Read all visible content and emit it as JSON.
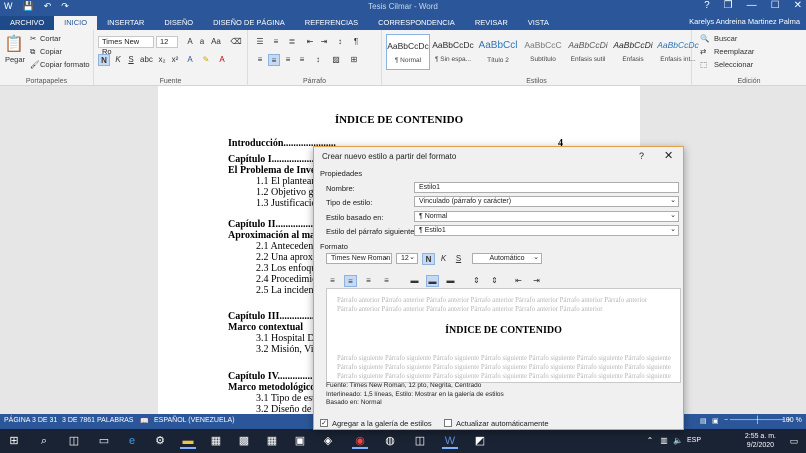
{
  "window": {
    "title": "Tesis Cilmar - Word",
    "help_glyph": "?",
    "restore_glyph": "❐",
    "min_glyph": "—",
    "max_glyph": "☐",
    "close_glyph": "✕",
    "user": "Karelys Andreina Martinez Palma"
  },
  "tabs": [
    "ARCHIVO",
    "INICIO",
    "INSERTAR",
    "DISEÑO",
    "DISEÑO DE PÁGINA",
    "REFERENCIAS",
    "CORRESPONDENCIA",
    "REVISAR",
    "VISTA"
  ],
  "ribbon": {
    "clipboard": {
      "paste": "Pegar",
      "cut": "Cortar",
      "copy": "Copiar",
      "format_painter": "Copiar formato",
      "label": "Portapapeles"
    },
    "font": {
      "name": "Times New Ro",
      "size": "12",
      "label": "Fuente"
    },
    "paragraph": {
      "label": "Párrafo"
    },
    "styles": {
      "label": "Estilos",
      "items": [
        {
          "preview": "AaBbCcDc",
          "name": "¶ Normal"
        },
        {
          "preview": "AaBbCcDc",
          "name": "¶ Sin espa..."
        },
        {
          "preview": "AaBbCcl",
          "name": "Título 2"
        },
        {
          "preview": "AaBbCcC",
          "name": "Subtítulo"
        },
        {
          "preview": "AaBbCcDi",
          "name": "Énfasis sutil"
        },
        {
          "preview": "AaBbCcDi",
          "name": "Énfasis"
        },
        {
          "preview": "AaBbCcDc",
          "name": "Énfasis int..."
        }
      ]
    },
    "editing": {
      "find": "Buscar",
      "replace": "Reemplazar",
      "select": "Seleccionar",
      "label": "Edición"
    }
  },
  "document": {
    "title": "ÍNDICE DE CONTENIDO",
    "lines": [
      {
        "text": "Introducción.....................",
        "bold": true
      },
      {
        "text": "4",
        "bold": true
      },
      {
        "text": "Capítulo   I.........................",
        "bold": true
      },
      {
        "text": "El Problema de Invest",
        "bold": true
      },
      {
        "text": "1.1 El planteam",
        "bold": false
      },
      {
        "text": "1.2 Objetivo gen",
        "bold": false
      },
      {
        "text": "1.3 Justificación",
        "bold": false
      },
      {
        "text": "Capítulo II.........................",
        "bold": true
      },
      {
        "text": "Aproximación al marc",
        "bold": true
      },
      {
        "text": "2.1 Antecedente",
        "bold": false
      },
      {
        "text": "2.2 Una aproxim",
        "bold": false
      },
      {
        "text": "2.3 Los enfoque",
        "bold": false
      },
      {
        "text": "2.4 Procedimien",
        "bold": false
      },
      {
        "text": "2.5 La incidenci",
        "bold": false
      },
      {
        "text": "Capítulo III.........................",
        "bold": true
      },
      {
        "text": "Marco contextual",
        "bold": true
      },
      {
        "text": "3.1 Hospital Dr.",
        "bold": false
      },
      {
        "text": "3.2  Misión, Vi",
        "bold": false
      },
      {
        "text": "Capítulo IV.........................",
        "bold": true
      },
      {
        "text": "Marco metodológico",
        "bold": true
      },
      {
        "text": "3.1  Tipo de est",
        "bold": false
      },
      {
        "text": "3.2 Diseño de la",
        "bold": false
      }
    ]
  },
  "dialog": {
    "title": "Crear nuevo estilo a partir del formato",
    "properties_label": "Propiedades",
    "name_label": "Nombre:",
    "name_value": "Estilo1",
    "type_label": "Tipo de estilo:",
    "type_value": "Vinculado (párrafo y carácter)",
    "based_label": "Estilo basado en:",
    "based_value": "¶  Normal",
    "next_label": "Estilo del párrafo siguiente:",
    "next_value": "¶  Estilo1",
    "format_label": "Formato",
    "font_value": "Times New Roman",
    "size_value": "12",
    "color_value": "Automático",
    "preview_gray": "Párrafo anterior Párrafo anterior Párrafo anterior Párrafo anterior Párrafo anterior Párrafo anterior Párrafo anterior",
    "preview_gray2": "Párrafo anterior Párrafo anterior Párrafo anterior Párrafo anterior Párrafo anterior Párrafo anterior",
    "preview_title": "ÍNDICE DE CONTENIDO",
    "preview_next": "Párrafo siguiente Párrafo siguiente Párrafo siguiente Párrafo siguiente Párrafo siguiente Párrafo siguiente Párrafo siguiente",
    "description": [
      "Fuente: Times New Roman, 12 pto, Negrita, Centrado",
      "    Interlineado:  1,5 líneas, Estilo: Mostrar en la galería de estilos",
      "    Basado en: Normal"
    ],
    "add_gallery": "Agregar a la galería de estilos",
    "auto_update": "Actualizar automáticamente"
  },
  "status": {
    "page": "PÁGINA 3 DE 31",
    "words": "3 DE 7861 PALABRAS",
    "language": "ESPAÑOL (VENEZUELA)",
    "zoom": "100 %"
  },
  "taskbar": {
    "time": "2:55 a. m.",
    "date": "9/2/2020",
    "lang": "ESP"
  }
}
